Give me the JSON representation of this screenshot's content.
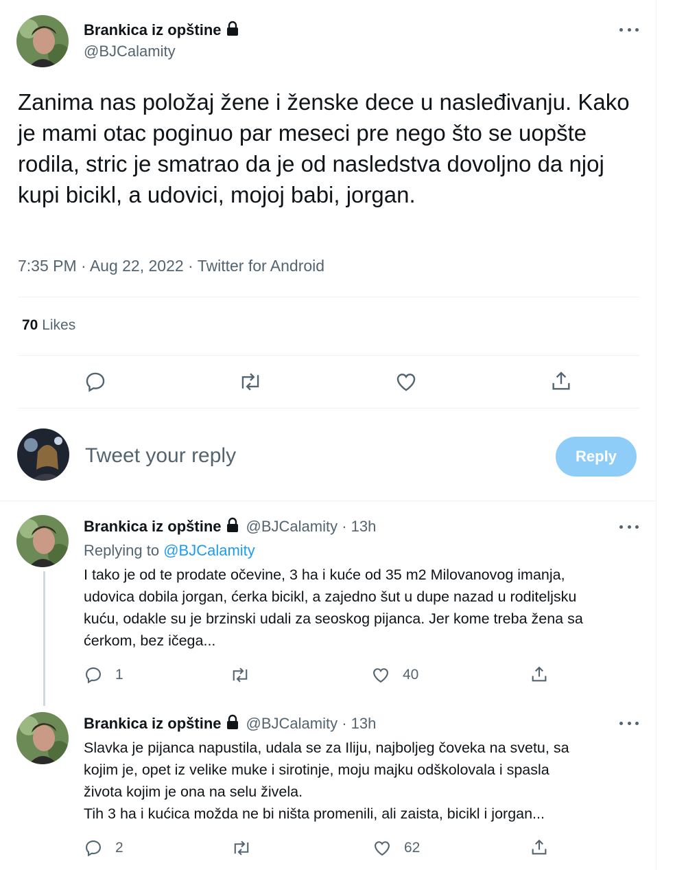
{
  "tweet": {
    "author_name": "Brankica iz opštine",
    "author_handle": "@BJCalamity",
    "text": "Zanima nas položaj žene i ženske dece u nasleđivanju. Kako je mami otac poginuo par meseci pre nego što se uopšte rodila, stric je smatrao da je od nasledstva dovoljno da njoj kupi bicikl, a udovici, mojoj babi, jorgan.",
    "meta": "7:35 PM · Aug 22, 2022 · Twitter for Android",
    "likes_count": "70",
    "likes_label": "Likes"
  },
  "compose": {
    "placeholder": "Tweet your reply",
    "reply_button": "Reply"
  },
  "replies": [
    {
      "author_name": "Brankica iz opštine",
      "meta": "@BJCalamity · 13h",
      "replying_prefix": "Replying to",
      "replying_to": "@BJCalamity",
      "text": "I tako je od te prodate očevine, 3 ha i kuće od 35 m2  Milovanovog imanja,\nudovica dobila jorgan, ćerka bicikl, a zajedno šut u dupe nazad u roditeljsku\nkuću, odakle su je brzinski udali za seoskog pijanca. Jer kome treba žena sa\nćerkom, bez ičega...",
      "reply_count": "1",
      "like_count": "40"
    },
    {
      "author_name": "Brankica iz opštine",
      "meta": "@BJCalamity · 13h",
      "text": "Slavka je pijanca napustila, udala se za Iliju, najboljeg čoveka na svetu, sa\nkojim je,  opet iz velike muke i sirotinje, moju majku odškolovala i spasla\nživota kojim je ona na selu živela.\nTih 3 ha i kućica možda ne bi ništa promenili, ali zaista, bicikl i jorgan...",
      "reply_count": "2",
      "like_count": "62"
    }
  ],
  "icons": {
    "reply": "reply-icon",
    "retweet": "retweet-icon",
    "like": "heart-icon",
    "share": "share-icon",
    "lock": "lock-icon",
    "more": "more-icon"
  },
  "colors": {
    "accent": "#1d9bf0",
    "reply_button_disabled": "#8ecdf8",
    "secondary_text": "#536471"
  }
}
